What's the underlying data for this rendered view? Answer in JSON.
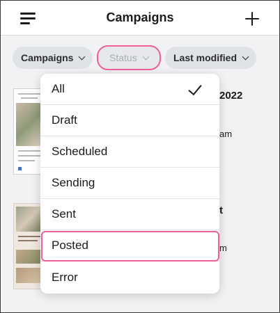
{
  "header": {
    "title": "Campaigns",
    "menu_icon": "menu-icon",
    "add_icon": "plus-icon"
  },
  "filters": {
    "campaigns_label": "Campaigns",
    "status_label": "Status",
    "last_modified_label": "Last modified"
  },
  "background_cards": [
    {
      "title_peek": "2022",
      "meta_peek": "am"
    },
    {
      "title_peek": "t",
      "meta_peek": "m"
    }
  ],
  "status_dropdown": {
    "selected": "All",
    "options": [
      "All",
      "Draft",
      "Scheduled",
      "Sending",
      "Sent",
      "Posted",
      "Error"
    ],
    "highlighted": "Posted"
  },
  "colors": {
    "highlight_ring": "#ee5f9c",
    "pill_bg": "#dfe3e8",
    "page_bg": "#f2f2f4"
  }
}
